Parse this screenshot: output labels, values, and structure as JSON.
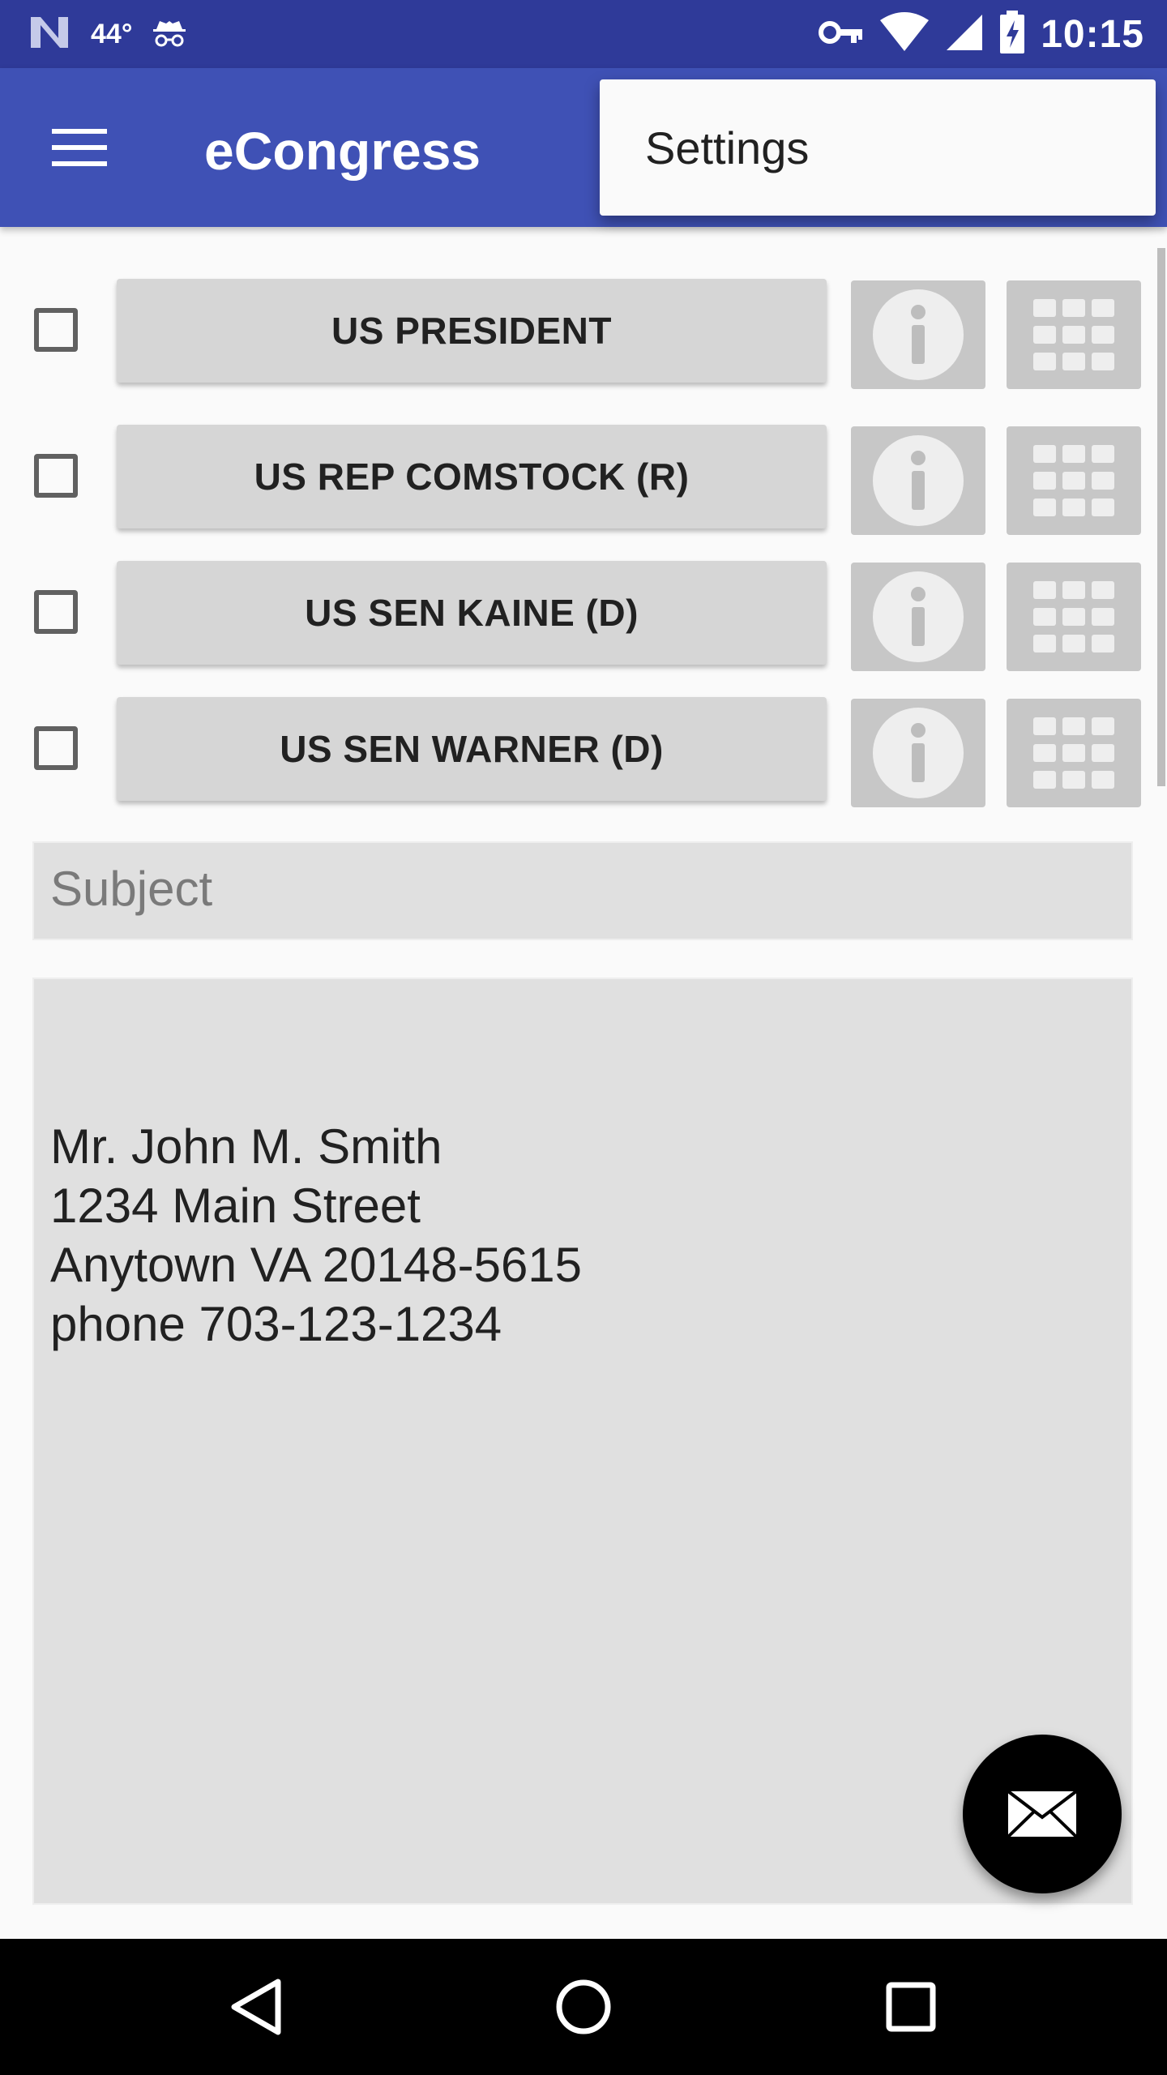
{
  "status_bar": {
    "temperature": "44°",
    "time": "10:15",
    "icons": [
      "n-logo-icon",
      "incognito-icon",
      "vpn-key-icon",
      "wifi-icon",
      "cell-signal-icon",
      "battery-charging-icon"
    ]
  },
  "app_bar": {
    "title": "eCongress",
    "menu_icon": "hamburger-menu-icon"
  },
  "overflow_menu": {
    "items": [
      {
        "label": "Settings"
      }
    ]
  },
  "representatives": [
    {
      "label": "US PRESIDENT",
      "checked": false
    },
    {
      "label": "US REP COMSTOCK (R)",
      "checked": false
    },
    {
      "label": "US SEN KAINE (D)",
      "checked": false
    },
    {
      "label": "US SEN WARNER (D)",
      "checked": false
    }
  ],
  "subject": {
    "placeholder": "Subject",
    "value": ""
  },
  "message": {
    "lines": [
      "Mr. John M. Smith",
      "1234 Main Street",
      "Anytown VA 20148-5615",
      "phone 703-123-1234"
    ]
  },
  "fab": {
    "icon": "envelope-icon"
  },
  "nav_bar": {
    "icons": [
      "back-icon",
      "home-icon",
      "recents-icon"
    ]
  },
  "colors": {
    "status_bar": "#2f3a99",
    "app_bar": "#3f51b5",
    "button_bg": "#d6d6d6",
    "field_bg": "#e0e0e0",
    "fab_bg": "#000000"
  }
}
